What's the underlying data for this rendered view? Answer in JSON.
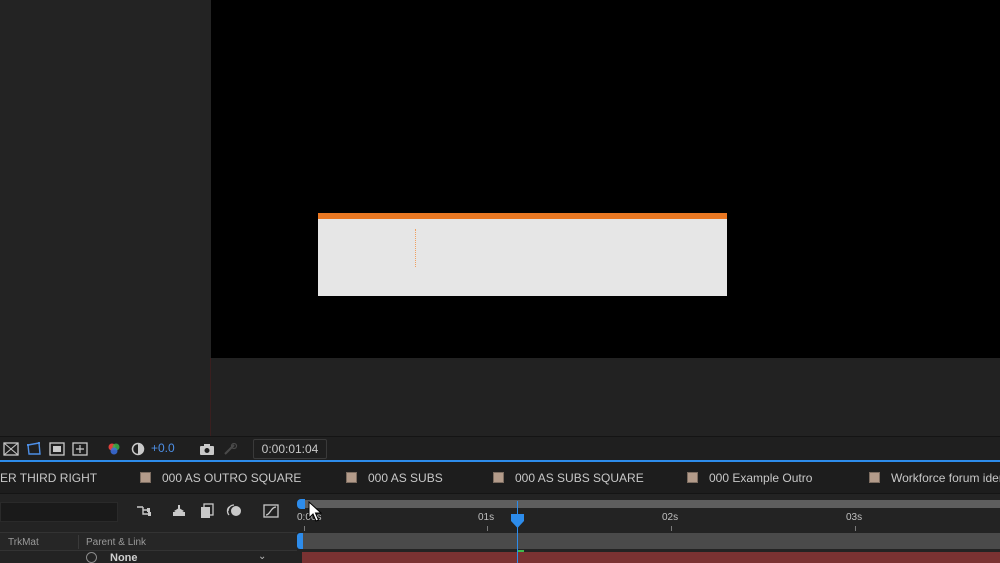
{
  "viewer": {
    "exposure_value": "+0.0",
    "timecode": "0:00:01:04"
  },
  "comp_tabs": [
    {
      "label": "ER THIRD RIGHT",
      "swatch": false
    },
    {
      "label": "000 AS OUTRO SQUARE",
      "swatch": true
    },
    {
      "label": "000 AS SUBS",
      "swatch": true
    },
    {
      "label": "000 AS SUBS SQUARE",
      "swatch": true
    },
    {
      "label": "000 Example Outro",
      "swatch": true
    },
    {
      "label": "Workforce forum ider",
      "swatch": true
    }
  ],
  "timeline": {
    "columns": {
      "trkmat": "TrkMat",
      "parent_link": "Parent & Link"
    },
    "layer_parent_value": "None",
    "ruler": [
      {
        "label": "0:00s"
      },
      {
        "label": "01s"
      },
      {
        "label": "02s"
      },
      {
        "label": "03s"
      }
    ],
    "current_time": "0:00:01:04"
  },
  "colors": {
    "accent": "#2d8ceb",
    "comp_orange": "#e87722",
    "layer_bar": "#7a3232",
    "tab_swatch": "#b39b8a"
  },
  "icons": {
    "toolbar": [
      "transparency-grid-icon",
      "mask-path-icon",
      "region-of-interest-icon",
      "safe-margins-icon",
      "color-channels-icon",
      "exposure-reset-icon",
      "snapshot-camera-icon",
      "show-snapshot-icon"
    ],
    "timeline": [
      "composition-flowchart-icon",
      "draft-3d-icon",
      "frame-blending-icon",
      "motion-blur-icon",
      "graph-editor-icon"
    ]
  }
}
